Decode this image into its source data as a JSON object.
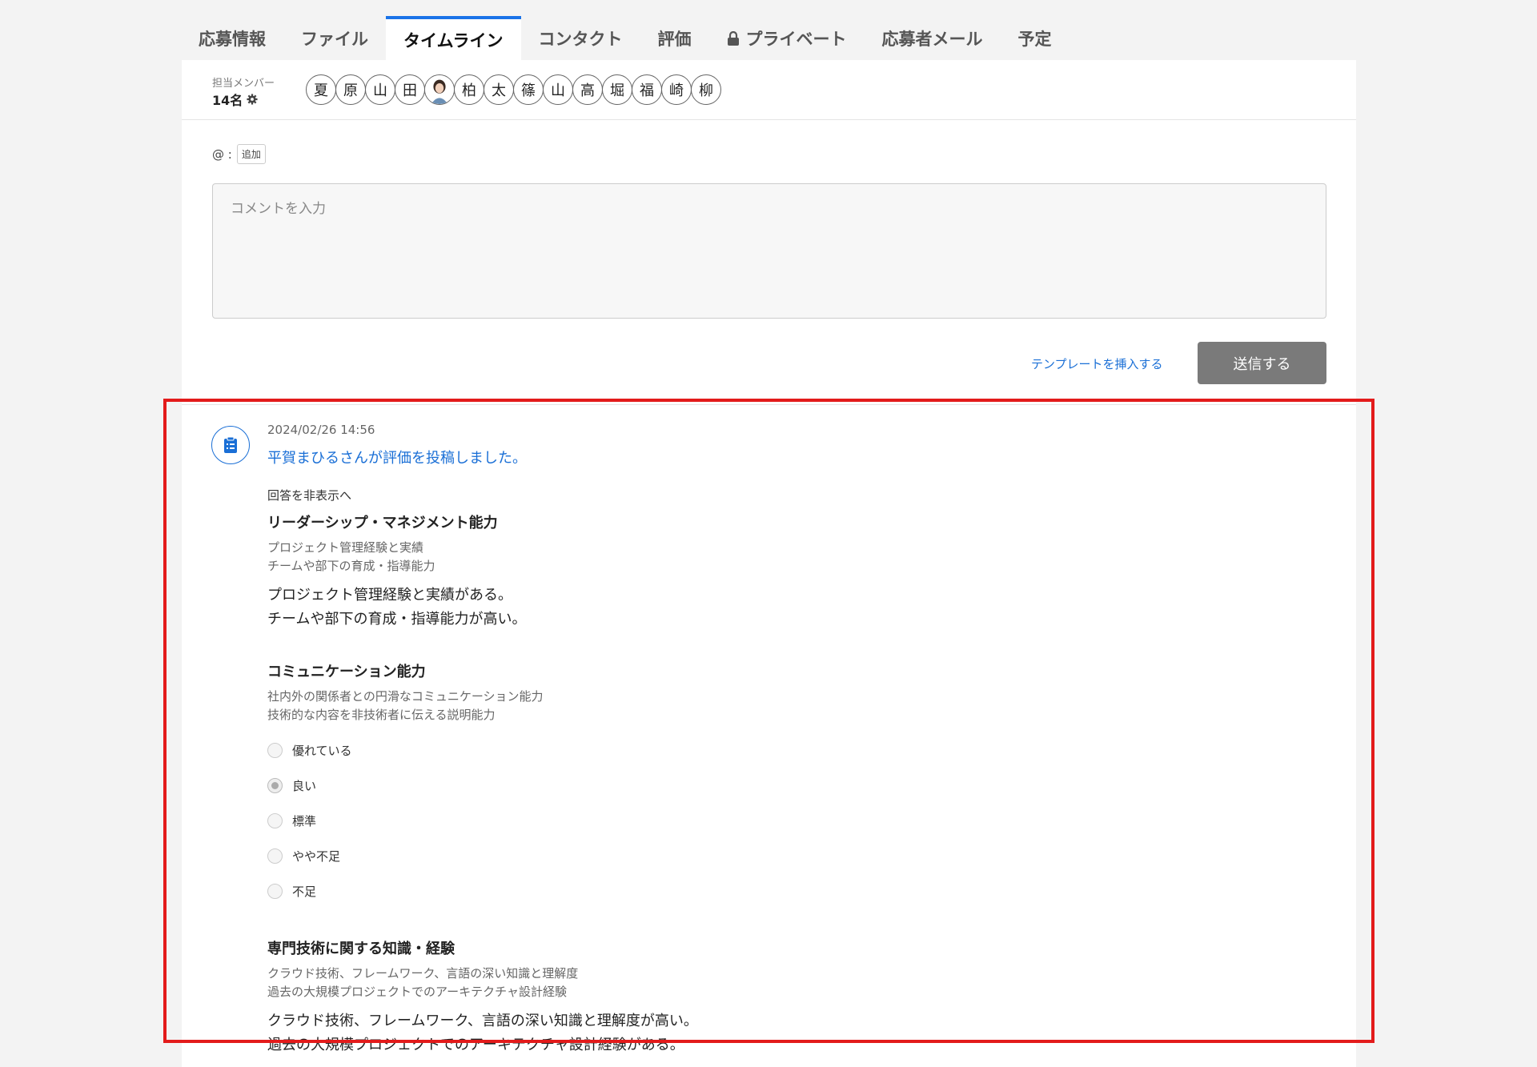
{
  "tabs": [
    {
      "label": "応募情報"
    },
    {
      "label": "ファイル"
    },
    {
      "label": "タイムライン",
      "active": true
    },
    {
      "label": "コンタクト"
    },
    {
      "label": "評価"
    },
    {
      "label": "プライベート",
      "icon": "lock-icon"
    },
    {
      "label": "応募者メール"
    },
    {
      "label": "予定"
    }
  ],
  "members": {
    "label": "担当メンバー",
    "count": "14名",
    "avatars": [
      "夏",
      "原",
      "山",
      "田",
      "",
      "柏",
      "太",
      "篠",
      "山",
      "高",
      "堀",
      "福",
      "崎",
      "柳"
    ]
  },
  "comment": {
    "mention_prefix": "@ :",
    "add_label": "追加",
    "placeholder": "コメントを入力",
    "insert_template": "テンプレートを挿入する",
    "send": "送信する"
  },
  "entry": {
    "icon": "clipboard-icon",
    "timestamp": "2024/02/26 14:56",
    "title": "平賀まひるさんが評価を投稿しました。",
    "toggle": "回答を非表示へ",
    "sections": [
      {
        "title": "リーダーシップ・マネジメント能力",
        "desc": [
          "プロジェクト管理経験と実績",
          "チームや部下の育成・指導能力"
        ],
        "answer": [
          "プロジェクト管理経験と実績がある。",
          "チームや部下の育成・指導能力が高い。"
        ]
      },
      {
        "title": "コミュニケーション能力",
        "desc": [
          "社内外の関係者との円滑なコミュニケーション能力",
          "技術的な内容を非技術者に伝える説明能力"
        ],
        "options": [
          "優れている",
          "良い",
          "標準",
          "やや不足",
          "不足"
        ],
        "selected": "良い"
      },
      {
        "title": "専門技術に関する知識・経験",
        "desc": [
          "クラウド技術、フレームワーク、言語の深い知識と理解度",
          "過去の大規模プロジェクトでのアーキテクチャ設計経験"
        ],
        "answer": [
          "クラウド技術、フレームワーク、言語の深い知識と理解度が高い。",
          "過去の大規模プロジェクトでのアーキテクチャ設計経験がある。"
        ]
      }
    ]
  },
  "colors": {
    "accent": "#1a6fd6",
    "highlight": "#e31b1b",
    "send_button": "#7a7a7a"
  }
}
